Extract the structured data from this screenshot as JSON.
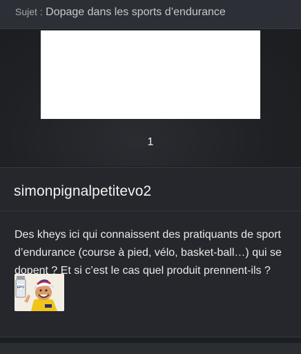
{
  "topic": {
    "prefix": "Sujet :",
    "title": "Dopage dans les sports d’endurance"
  },
  "media": {
    "page_number": "1"
  },
  "post": {
    "author": "simonpignalpetitevo2",
    "body": "Des kheys ici qui connaissent des pratiquants de sport d’endurance (course à pied, vélo, basket-ball…) qui se dopent ? Et si c’est le cas quel produit prennent-ils ?",
    "sticker": {
      "icon": "risitas-epo-sticker",
      "vial_label": "EPO"
    }
  }
}
